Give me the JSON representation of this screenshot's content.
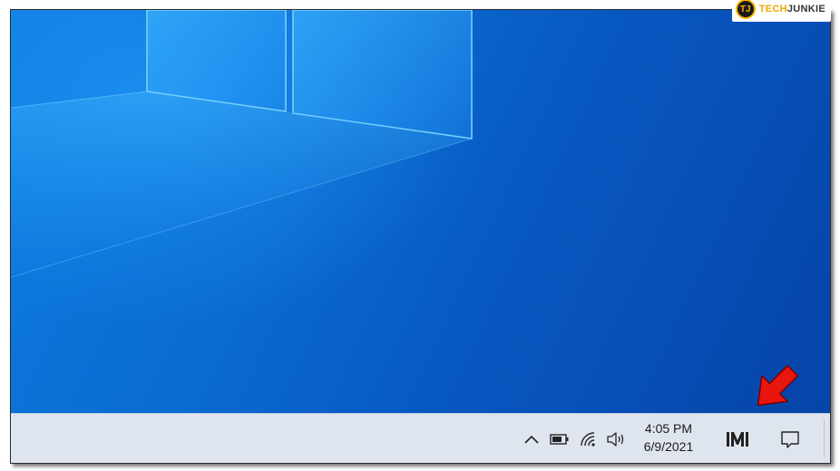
{
  "watermark": {
    "badge": "TJ",
    "brand_part1": "TECH",
    "brand_part2": "JUNKIE"
  },
  "taskbar": {
    "tray": {
      "show_hidden_icons_icon": "chevron-up-icon",
      "battery_icon": "battery-icon",
      "wifi_icon": "wifi-icon",
      "volume_icon": "speaker-icon",
      "app_icon": "media-app-icon",
      "action_center_icon": "notification-icon"
    },
    "clock": {
      "time": "4:05 PM",
      "date": "6/9/2021"
    }
  },
  "annotation": {
    "arrow_color": "#e8160f",
    "pointing_to": "action-center-button"
  },
  "colors": {
    "desktop_blue": "#0a6bd0",
    "taskbar_bg": "#dfe5ee",
    "tray_icon": "#222222"
  }
}
